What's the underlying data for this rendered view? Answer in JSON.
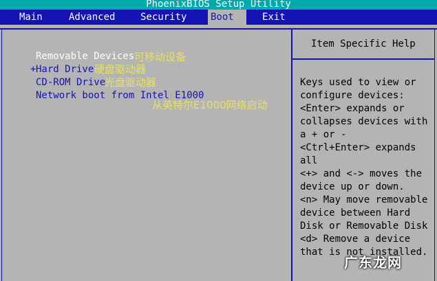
{
  "title": "PhoenixBIOS Setup Utility",
  "menu": [
    {
      "label": "Main",
      "active": false
    },
    {
      "label": "Advanced",
      "active": false
    },
    {
      "label": "Security",
      "active": false
    },
    {
      "label": "Boot",
      "active": true
    },
    {
      "label": "Exit",
      "active": false
    }
  ],
  "boot_list": {
    "marker": "+",
    "items": [
      {
        "label": "Removable Devices",
        "annotation": "可移动设备"
      },
      {
        "label": "Hard Drive",
        "annotation": "硬盘驱动器"
      },
      {
        "label": "CD-ROM Drive",
        "annotation": "光盘驱动器"
      },
      {
        "label": "Network boot from Intel E1000",
        "annotation": "从英特尔E1000网络启动"
      }
    ]
  },
  "help": {
    "title": "Item Specific Help",
    "lines": [
      "Keys used to view or",
      "configure devices:",
      "<Enter> expands or",
      "collapses devices with",
      "a + or -",
      "<Ctrl+Enter> expands",
      "all",
      "<+> and <-> moves the",
      "device up or down.",
      "<n> May move removable",
      "device between Hard",
      "Disk or Removable Disk",
      "<d> Remove a device",
      "that is not installed."
    ]
  },
  "watermark": "广东龙网",
  "colors": {
    "bios_blue": "#1414b4",
    "bios_gray": "#b4b4b4",
    "title_cyan": "#00aaaa",
    "annotation_yellow": "#e8e060"
  }
}
